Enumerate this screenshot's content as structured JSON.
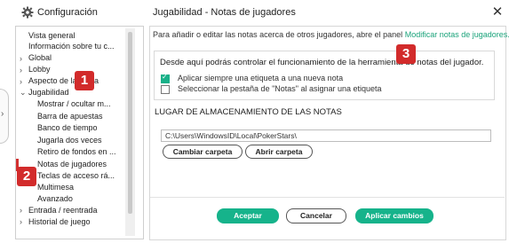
{
  "window": {
    "app_title": "Configuración",
    "panel_title": "Jugabilidad - Notas de jugadores",
    "gear_icon": "gear-icon",
    "close_icon": "close-icon",
    "close_glyph": "✕"
  },
  "sidebar": {
    "items": [
      {
        "label": "Vista general",
        "caret": ""
      },
      {
        "label": "Información sobre tu c...",
        "caret": ""
      },
      {
        "label": "Global",
        "caret": "›"
      },
      {
        "label": "Lobby",
        "caret": "›"
      },
      {
        "label": "Aspecto de la mesa",
        "caret": "›"
      },
      {
        "label": "Jugabilidad",
        "caret": "⌄"
      },
      {
        "label": "Mostrar / ocultar m...",
        "caret": ""
      },
      {
        "label": "Barra de apuestas",
        "caret": ""
      },
      {
        "label": "Banco de tiempo",
        "caret": ""
      },
      {
        "label": "Jugarla dos veces",
        "caret": ""
      },
      {
        "label": "Retiro de fondos en ...",
        "caret": ""
      },
      {
        "label": "Notas de jugadores",
        "caret": ""
      },
      {
        "label": "Teclas de acceso rá...",
        "caret": ""
      },
      {
        "label": "Multimesa",
        "caret": ""
      },
      {
        "label": "Avanzado",
        "caret": ""
      },
      {
        "label": "Entrada / reentrada",
        "caret": "›"
      },
      {
        "label": "Historial de juego",
        "caret": "›"
      }
    ],
    "selected": "Notas de jugadores",
    "collapse_glyph": "›"
  },
  "content": {
    "intro_text": "Para añadir o editar las notas acerca de otros jugadores, abre el panel",
    "intro_link": "Modificar notas de jugadores.",
    "box_title": "Desde aquí podrás controlar el funcionamiento de la herramienta de notas del jugador.",
    "checkbox1": {
      "label": "Aplicar siempre una etiqueta a una nueva nota",
      "checked": true
    },
    "checkbox2": {
      "label": "Seleccionar la pestaña de \"Notas\" al asignar una etiqueta",
      "checked": false
    },
    "storage_title": "LUGAR DE ALMACENAMIENTO DE LAS NOTAS",
    "path_value": "C:\\Users\\WindowsID\\Local\\PokerStars\\",
    "change_folder": "Cambiar carpeta",
    "open_folder": "Abrir carpeta"
  },
  "footer": {
    "accept": "Aceptar",
    "cancel": "Cancelar",
    "apply": "Aplicar cambios"
  },
  "annotations": [
    "1",
    "2",
    "3"
  ],
  "colors": {
    "accent": "#16b38b",
    "badge": "#d22b2b",
    "selection": "#d23030"
  }
}
